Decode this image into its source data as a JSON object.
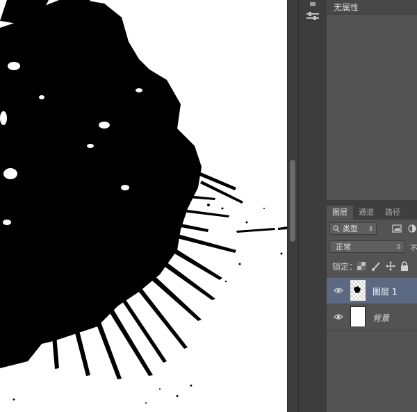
{
  "properties_panel": {
    "title": "无属性"
  },
  "layers_panel": {
    "tabs": [
      {
        "label": "图层",
        "active": true
      },
      {
        "label": "通道",
        "active": false
      },
      {
        "label": "路径",
        "active": false
      }
    ],
    "filter": {
      "kind_label": "类型"
    },
    "blend_mode": {
      "value": "正常",
      "opacity_label": "不"
    },
    "lock_label": "锁定：",
    "layers": [
      {
        "name": "图层 1",
        "selected": true
      },
      {
        "name": "背景",
        "selected": false
      }
    ]
  },
  "colors": {
    "selected_layer": "#5b6a82",
    "panel_bg": "#535353",
    "canvas": "#ffffff"
  },
  "icons": [
    "search-icon",
    "image-filter-icon",
    "adjustment-filter-icon",
    "checkerboard-lock-icon",
    "brush-lock-icon",
    "move-lock-icon",
    "padlock-icon",
    "eye-icon"
  ]
}
